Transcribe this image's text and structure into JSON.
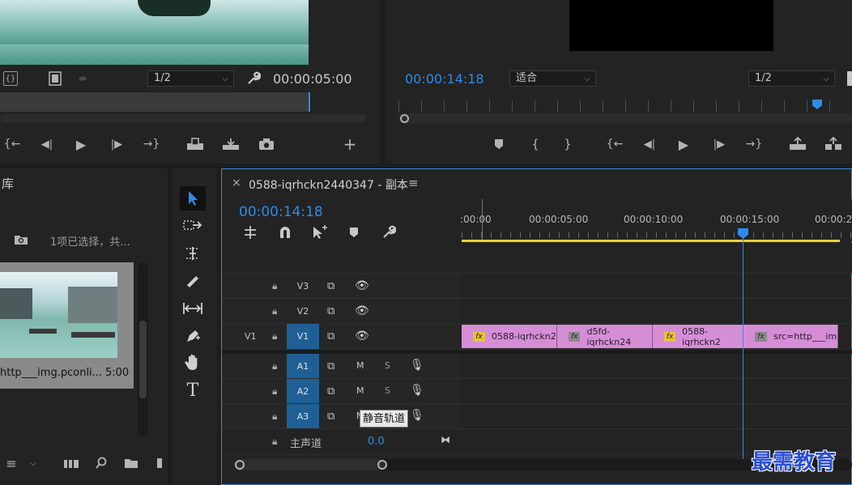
{
  "source_monitor": {
    "zoom_label": "1/2",
    "timecode": "00:00:05:00"
  },
  "program_monitor": {
    "timecode": "00:00:14:18",
    "fit_label": "适合",
    "zoom_label": "1/2"
  },
  "project_panel": {
    "tab_label": "库",
    "selection_status": "1项已选择，共...",
    "item": {
      "name": "http___img.pconli...",
      "duration": "5:00"
    }
  },
  "timeline": {
    "sequence_title": "0588-iqrhckn2440347 - 副本",
    "close_label": "×",
    "menu_label": "≡",
    "timecode": "00:00:14:18",
    "ruler_labels": [
      ":00:00",
      "00:00:05:00",
      "00:00:10:00",
      "00:00:15:00",
      "00:00:2"
    ],
    "playhead_fraction": 0.59,
    "tracks": {
      "v3": "V3",
      "v2": "V2",
      "v1_src": "V1",
      "v1": "V1",
      "a1": "A1",
      "a2": "A2",
      "a3": "A3",
      "mute": "M",
      "solo": "S"
    },
    "clips": [
      {
        "fx": "fx",
        "name": "0588-iqrhckn2",
        "fx_color": "yellow"
      },
      {
        "fx": "fx",
        "name": "d5fd-iqrhckn24",
        "fx_color": "gray"
      },
      {
        "fx": "fx",
        "name": "0588-iqrhckn2",
        "fx_color": "yellow"
      },
      {
        "fx": "fx",
        "name": "src=http___im",
        "fx_color": "gray"
      }
    ],
    "master": {
      "label": "主声道",
      "value": "0.0"
    },
    "tooltip": "静音轨道"
  },
  "watermark": "最需教育",
  "colors": {
    "accent_blue": "#2d8ceb",
    "clip_pink": "#d58ed6",
    "track_blue": "#1f5f95",
    "work_area_yellow": "#e8d23a"
  }
}
